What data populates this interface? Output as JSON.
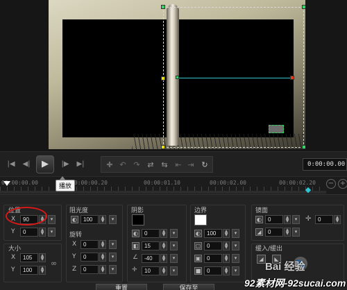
{
  "transport": {
    "tooltip": "播放",
    "timecode": "0:00:00.00",
    "buttons": [
      "go-to-start",
      "prev-frame",
      "play",
      "next-frame",
      "go-to-end"
    ]
  },
  "ruler": {
    "labels": [
      "00:00:00.00",
      "00:00:00.20",
      "00:00:01.10",
      "00:00:02.00",
      "00:00:02.20"
    ]
  },
  "position": {
    "title": "位置",
    "x_label": "X",
    "x_value": "90",
    "y_label": "Y",
    "y_value": "0"
  },
  "size": {
    "title": "大小",
    "x_label": "X",
    "x_value": "105",
    "y_label": "Y",
    "y_value": "100"
  },
  "opacity": {
    "title": "阻光度",
    "value": "100"
  },
  "rotation": {
    "title": "旋转",
    "x_label": "X",
    "x_value": "0",
    "y_label": "Y",
    "y_value": "0",
    "z_label": "Z",
    "z_value": "0"
  },
  "shadow": {
    "title": "阴影",
    "color": "#000000",
    "opacity": "0",
    "distance": "15",
    "angle": "-40",
    "blur": "10"
  },
  "border": {
    "title": "边界",
    "color": "#ffffff",
    "opacity": "100",
    "width": "0",
    "v1": "0",
    "v2": "0"
  },
  "mirror": {
    "title": "镜面",
    "v1": "0",
    "v2": "0",
    "v3": "0"
  },
  "fade": {
    "title": "缓入/缓出"
  },
  "buttons": {
    "reset": "重置",
    "save_as": "保存至"
  },
  "watermark": {
    "baidu": "Bai 经验",
    "site": "92素材网-92sucai.com"
  },
  "colors": {
    "guide": "#3ac8d0",
    "handle_yellow": "#e8e000",
    "handle_green": "#34d46a",
    "handle_red": "#e23a1a",
    "annotation": "#d91818"
  }
}
